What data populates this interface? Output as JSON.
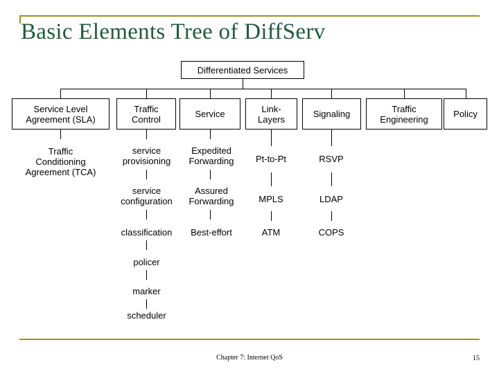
{
  "slide": {
    "title": "Basic Elements Tree of DiffServ",
    "footer_center": "Chapter 7: Internet QoS",
    "footer_page": "15",
    "accent_color": "#9a8f1e",
    "title_color": "#1d5b3a"
  },
  "diagram": {
    "type": "tree",
    "root": "Differentiated Services",
    "level1": [
      {
        "label": "Service Level\nAgreement (SLA)",
        "boxed": true
      },
      {
        "label": "Traffic\nControl",
        "boxed": true
      },
      {
        "label": "Service",
        "boxed": true
      },
      {
        "label": "Link-\nLayers",
        "boxed": true
      },
      {
        "label": "Signaling",
        "boxed": true
      },
      {
        "label": "Traffic\nEngineering",
        "boxed": true
      },
      {
        "label": "Policy",
        "boxed": true
      }
    ],
    "columns": [
      {
        "parent": "Service Level Agreement (SLA)",
        "items": [
          "Traffic\nConditioning\nAgreement (TCA)"
        ]
      },
      {
        "parent": "Traffic Control",
        "items": [
          "service\nprovisioning",
          "service\nconfiguration",
          "classification",
          "policer",
          "marker",
          "scheduler"
        ]
      },
      {
        "parent": "Service",
        "items": [
          "Expedited\nForwarding",
          "Assured\nForwarding",
          "Best-effort"
        ]
      },
      {
        "parent": "Link-Layers",
        "items": [
          "Pt-to-Pt",
          "MPLS",
          "ATM"
        ]
      },
      {
        "parent": "Signaling",
        "items": [
          "RSVP",
          "LDAP",
          "COPS"
        ]
      },
      {
        "parent": "Traffic Engineering",
        "items": []
      },
      {
        "parent": "Policy",
        "items": []
      }
    ]
  }
}
